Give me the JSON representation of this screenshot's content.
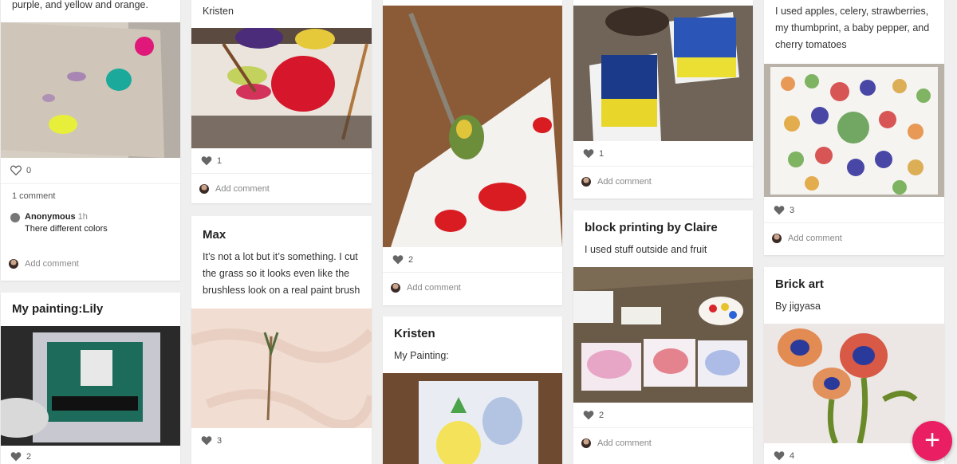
{
  "colors": {
    "accent": "#e91e63",
    "background": "#efefef",
    "card": "#ffffff"
  },
  "fab": {
    "label": "+",
    "icon": "plus-icon"
  },
  "col1": {
    "post1": {
      "text": "purple, and yellow and orange.",
      "likes": "0",
      "comment_count": "1 comment",
      "comment_author": "Anonymous",
      "comment_time": "1h",
      "comment_text": "There different colors",
      "add_comment": "Add comment"
    },
    "post2": {
      "title": "My painting:Lily",
      "likes": "2"
    }
  },
  "col2": {
    "post1": {
      "text": "Kristen",
      "likes": "1",
      "add_comment": "Add comment"
    },
    "post2": {
      "title": "Max",
      "text": "It’s not a lot but it’s something. I cut the grass so it looks even like the brushless look on a real paint brush",
      "likes": "3"
    }
  },
  "col3": {
    "post1": {
      "likes": "2",
      "add_comment": "Add comment"
    },
    "post2": {
      "title": "Kristen",
      "text": "My Painting:"
    }
  },
  "col4": {
    "post1": {
      "likes": "1",
      "add_comment": "Add comment"
    },
    "post2": {
      "title": "block printing by Claire",
      "text": "I used stuff outside and fruit",
      "likes": "2",
      "add_comment": "Add comment"
    }
  },
  "col5": {
    "post1": {
      "text": "I used apples, celery, strawberries, my thumbprint, a baby pepper, and cherry tomatoes",
      "likes": "3",
      "add_comment": "Add comment"
    },
    "post2": {
      "title": "Brick art",
      "text": "By jigyasa",
      "likes": "4"
    }
  }
}
